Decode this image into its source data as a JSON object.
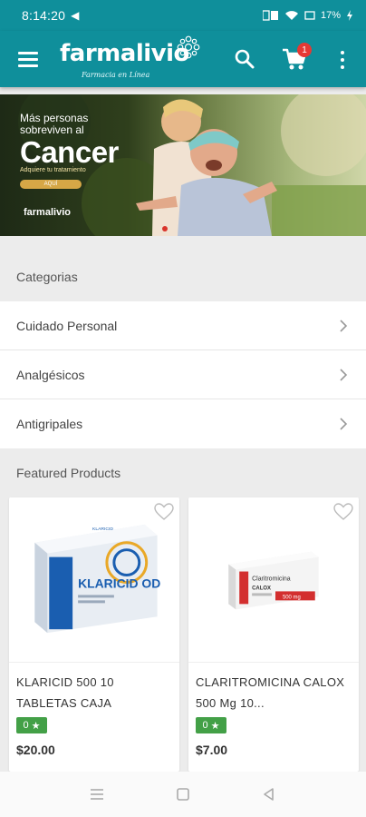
{
  "status_bar": {
    "time": "8:14:20",
    "battery": "17%"
  },
  "app_bar": {
    "logo_text": "farmalivio",
    "logo_tagline": "Farmacia en Línea",
    "cart_count": "1"
  },
  "banner": {
    "line1": "Más personas",
    "line2": "sobreviven al",
    "headline": "Cancer",
    "subline": "Adquiere tu tratamiento",
    "cta": "AQUÍ",
    "brand": "farmalivio"
  },
  "categories": {
    "header": "Categorias",
    "items": [
      {
        "label": "Cuidado Personal"
      },
      {
        "label": "Analgésicos"
      },
      {
        "label": "Antigripales"
      }
    ]
  },
  "featured": {
    "header": "Featured Products",
    "products": [
      {
        "name": "KLARICID 500 10 TABLETAS CAJA",
        "rating": "0",
        "price": "$20.00",
        "box_label": "KLARICID OD",
        "box_brand": "KLARICID"
      },
      {
        "name": "CLARITROMICINA CALOX 500 Mg 10...",
        "rating": "0",
        "price": "$7.00",
        "box_label": "Claritromicina",
        "box_brand": "CALOX",
        "box_dose": "500 mg"
      }
    ]
  },
  "colors": {
    "primary": "#0f8f9b",
    "badge": "#e53935",
    "rating": "#43a047"
  }
}
